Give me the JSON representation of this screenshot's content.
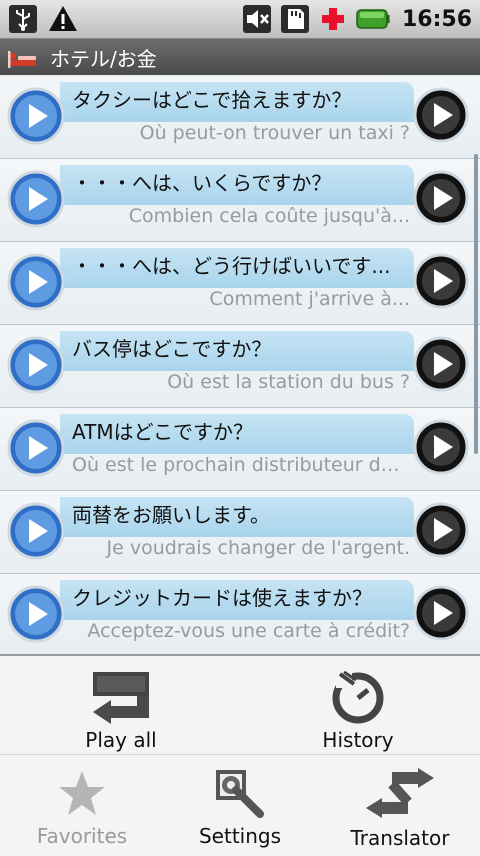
{
  "status_bar": {
    "time": "16:56",
    "icons": [
      "usb-icon",
      "warning-icon",
      "mute-icon",
      "sd-card-icon",
      "medical-cross-icon",
      "battery-icon"
    ]
  },
  "title_bar": {
    "title": "ホテル/お金",
    "icon": "hotel-bed-icon"
  },
  "phrases": [
    {
      "jp": "タクシーはどこで拾えますか？",
      "fr": "Où peut-on trouver un taxi ?"
    },
    {
      "jp": "・・・へは、いくらですか？",
      "fr": "Combien cela coûte jusqu'à..."
    },
    {
      "jp": "・・・へは、どう行けばいいです...",
      "fr": "Comment j'arrive à..."
    },
    {
      "jp": "バス停はどこですか？",
      "fr": "Où est la station du bus ?"
    },
    {
      "jp": "ATMはどこですか？",
      "fr": "Où est le prochain distributeur de ..."
    },
    {
      "jp": "両替をお願いします。",
      "fr": "Je voudrais changer de l'argent."
    },
    {
      "jp": "クレジットカードは使えますか？",
      "fr": "Acceptez-vous une carte à crédit?"
    }
  ],
  "menu": {
    "play_all": "Play all",
    "history": "History",
    "favorites": "Favorites",
    "settings": "Settings",
    "translator": "Translator"
  },
  "colors": {
    "bubble": "#b5dbf0",
    "play_left": "#2f6fc8",
    "play_right": "#111111",
    "menu_bg": "#f4f4f4",
    "disabled_text": "#9a9a9a"
  }
}
